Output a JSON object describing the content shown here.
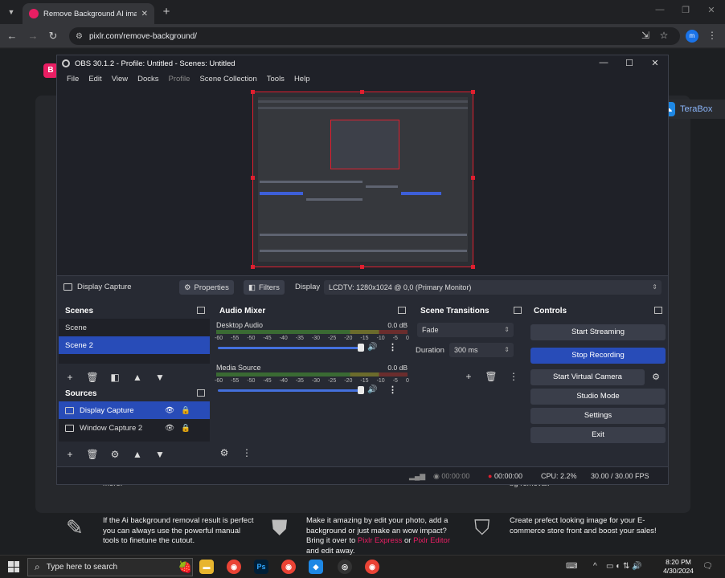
{
  "browser": {
    "tab_title": "Remove Background AI image",
    "url": "pixlr.com/remove-background/",
    "profile_initial": "m"
  },
  "page": {
    "terabox_label": "TeraBox",
    "behind_left": "more.",
    "behind_right": "bg removal.",
    "feature1": "If the Ai background removal result is perfect you can always use the powerful manual tools to finetune the cutout.",
    "feature2_a": "Make it amazing by edit your photo, add a background or just make an wow impact? Bring it over to",
    "feature2_link1": "Pixlr Express",
    "feature2_or": "or",
    "feature2_link2": "Pixlr Editor",
    "feature2_b": "and edit away.",
    "feature3": "Create prefect looking image for your E-commerce store front and boost your sales!"
  },
  "obs": {
    "title": "OBS 30.1.2 - Profile: Untitled - Scenes: Untitled",
    "menu": [
      "File",
      "Edit",
      "View",
      "Docks",
      "Profile",
      "Scene Collection",
      "Tools",
      "Help"
    ],
    "source_bar": {
      "selected_source": "Display Capture",
      "properties": "Properties",
      "filters": "Filters",
      "display_label": "Display",
      "display_value": "LCDTV: 1280x1024 @ 0,0 (Primary Monitor)"
    },
    "scenes": {
      "title": "Scenes",
      "items": [
        "Scene",
        "Scene 2"
      ]
    },
    "sources": {
      "title": "Sources",
      "items": [
        "Display Capture",
        "Window Capture 2"
      ]
    },
    "mixer": {
      "title": "Audio Mixer",
      "scale": [
        "-60",
        "-55",
        "-50",
        "-45",
        "-40",
        "-35",
        "-30",
        "-25",
        "-20",
        "-15",
        "-10",
        "-5",
        "0"
      ],
      "channels": [
        {
          "name": "Desktop Audio",
          "db": "0.0 dB"
        },
        {
          "name": "Media Source",
          "db": "0.0 dB"
        }
      ]
    },
    "transitions": {
      "title": "Scene Transitions",
      "type": "Fade",
      "duration_label": "Duration",
      "duration_value": "300 ms"
    },
    "controls": {
      "title": "Controls",
      "start_streaming": "Start Streaming",
      "stop_recording": "Stop Recording",
      "start_virtual_camera": "Start Virtual Camera",
      "studio_mode": "Studio Mode",
      "settings": "Settings",
      "exit": "Exit"
    },
    "status": {
      "stream_time": "00:00:00",
      "rec_time": "00:00:00",
      "cpu": "CPU: 2.2%",
      "fps": "30.00 / 30.00 FPS"
    }
  },
  "taskbar": {
    "search_placeholder": "Type here to search",
    "time": "8:20 PM",
    "date": "4/30/2024"
  }
}
